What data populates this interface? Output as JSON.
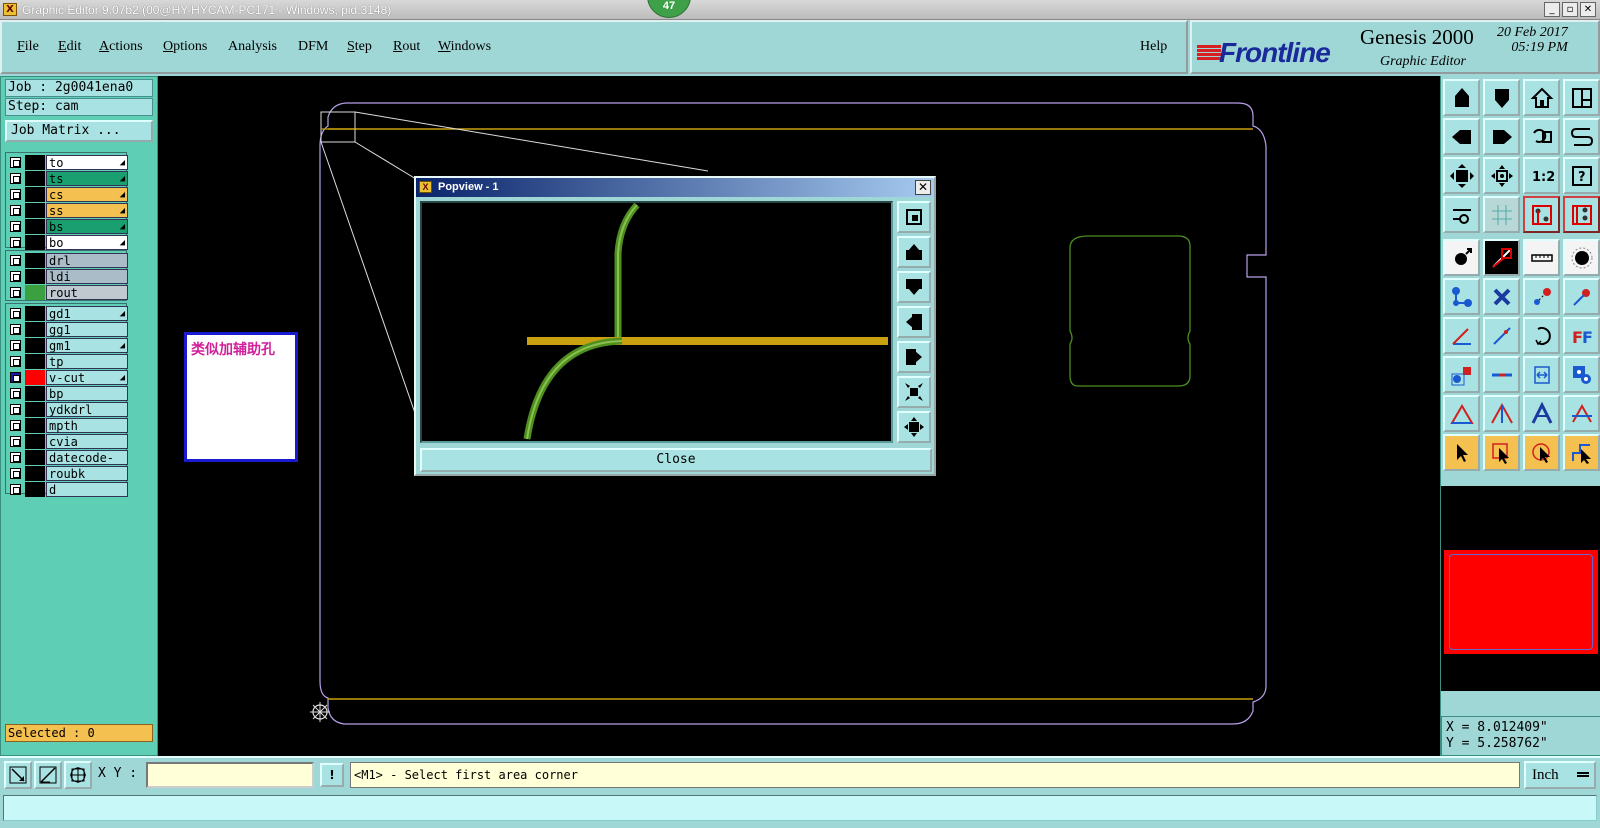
{
  "window": {
    "title": "Graphic Editor 9.07b2 (00@HY-HYCAM-PC171 - Windows, pid:3148)",
    "badge": "47"
  },
  "menu": {
    "items": [
      {
        "label": "File",
        "u": "F",
        "rest": "ile"
      },
      {
        "label": "Edit",
        "u": "E",
        "rest": "dit"
      },
      {
        "label": "Actions",
        "u": "A",
        "rest": "ctions"
      },
      {
        "label": "Options",
        "u": "O",
        "rest": "ptions"
      },
      {
        "label": "Analysis",
        "u": "",
        "rest": "Analysis"
      },
      {
        "label": "DFM",
        "u": "",
        "rest": "DFM"
      },
      {
        "label": "Step",
        "u": "S",
        "rest": "tep"
      },
      {
        "label": "Rout",
        "u": "R",
        "rest": "out"
      },
      {
        "label": "Windows",
        "u": "W",
        "rest": "indows"
      }
    ],
    "help": "Help"
  },
  "brand": {
    "logo": "Frontline",
    "product": "Genesis 2000",
    "subtitle": "Graphic Editor",
    "date": "20 Feb 2017",
    "time": "05:19 PM"
  },
  "job": {
    "job": "Job : 2g0041ena0",
    "step": "Step: cam",
    "matrix": "Job Matrix ..."
  },
  "layers": {
    "group1": [
      {
        "name": "to",
        "swatch": "#000000",
        "bg": "#ffffff",
        "arrow": true
      },
      {
        "name": "ts",
        "swatch": "#000000",
        "bg": "#1aa070",
        "arrow": true
      },
      {
        "name": "cs",
        "swatch": "#000000",
        "bg": "#f4c050",
        "arrow": true
      },
      {
        "name": "ss",
        "swatch": "#000000",
        "bg": "#f4c050",
        "arrow": true
      },
      {
        "name": "bs",
        "swatch": "#000000",
        "bg": "#1aa070",
        "arrow": true
      },
      {
        "name": "bo",
        "swatch": "#000000",
        "bg": "#ffffff",
        "arrow": true
      }
    ],
    "group2": [
      {
        "name": "drl",
        "swatch": "#000000",
        "bg": "#a9bcc8",
        "arrow": false
      },
      {
        "name": "ldi",
        "swatch": "#000000",
        "bg": "#a9bcc8",
        "arrow": false
      },
      {
        "name": "rout",
        "swatch": "#3aa040",
        "bg": "#c0c8d0",
        "arrow": false
      }
    ],
    "group3": [
      {
        "name": "gd1",
        "swatch": "#000000",
        "bg": "#a9e2e2",
        "arrow": true
      },
      {
        "name": "gg1",
        "swatch": "#000000",
        "bg": "#a9e2e2",
        "arrow": false
      },
      {
        "name": "gm1",
        "swatch": "#000000",
        "bg": "#a9e2e2",
        "arrow": true
      },
      {
        "name": "tp",
        "swatch": "#000000",
        "bg": "#a9e2e2",
        "arrow": false
      },
      {
        "name": "v-cut",
        "swatch": "#ff0000",
        "bg": "#a9e2e2",
        "arrow": true,
        "active": true
      },
      {
        "name": "bp",
        "swatch": "#000000",
        "bg": "#a9e2e2",
        "arrow": false
      },
      {
        "name": "ydkdrl",
        "swatch": "#000000",
        "bg": "#a9e2e2",
        "arrow": false
      },
      {
        "name": "mpth",
        "swatch": "#000000",
        "bg": "#a9e2e2",
        "arrow": false
      },
      {
        "name": "cvia",
        "swatch": "#000000",
        "bg": "#a9e2e2",
        "arrow": false
      },
      {
        "name": "datecode-to",
        "swatch": "#000000",
        "bg": "#a9e2e2",
        "arrow": false
      },
      {
        "name": "roubk",
        "swatch": "#000000",
        "bg": "#a9e2e2",
        "arrow": false
      },
      {
        "name": "d",
        "swatch": "#000000",
        "bg": "#a9e2e2",
        "arrow": false
      }
    ]
  },
  "selected": "Selected : 0",
  "annotation": "类似加辅助孔",
  "popup": {
    "title": "Popview - 1",
    "close": "Close"
  },
  "coords": {
    "x": "X = 8.012409\"",
    "y": "Y = 5.258762\""
  },
  "cmd": {
    "xy_label": "X Y :",
    "xy_value": "",
    "prompt": "<M1> - Select first area corner",
    "unit": "Inch"
  },
  "colors": {
    "panel": "#9fd6d6",
    "layer_panel": "#5ecfb4",
    "accent_yellow": "#f4c050",
    "canvas": "#000000",
    "profile": "#b8a0e8",
    "trace": "#4e8f20",
    "bar": "#c8a010"
  }
}
